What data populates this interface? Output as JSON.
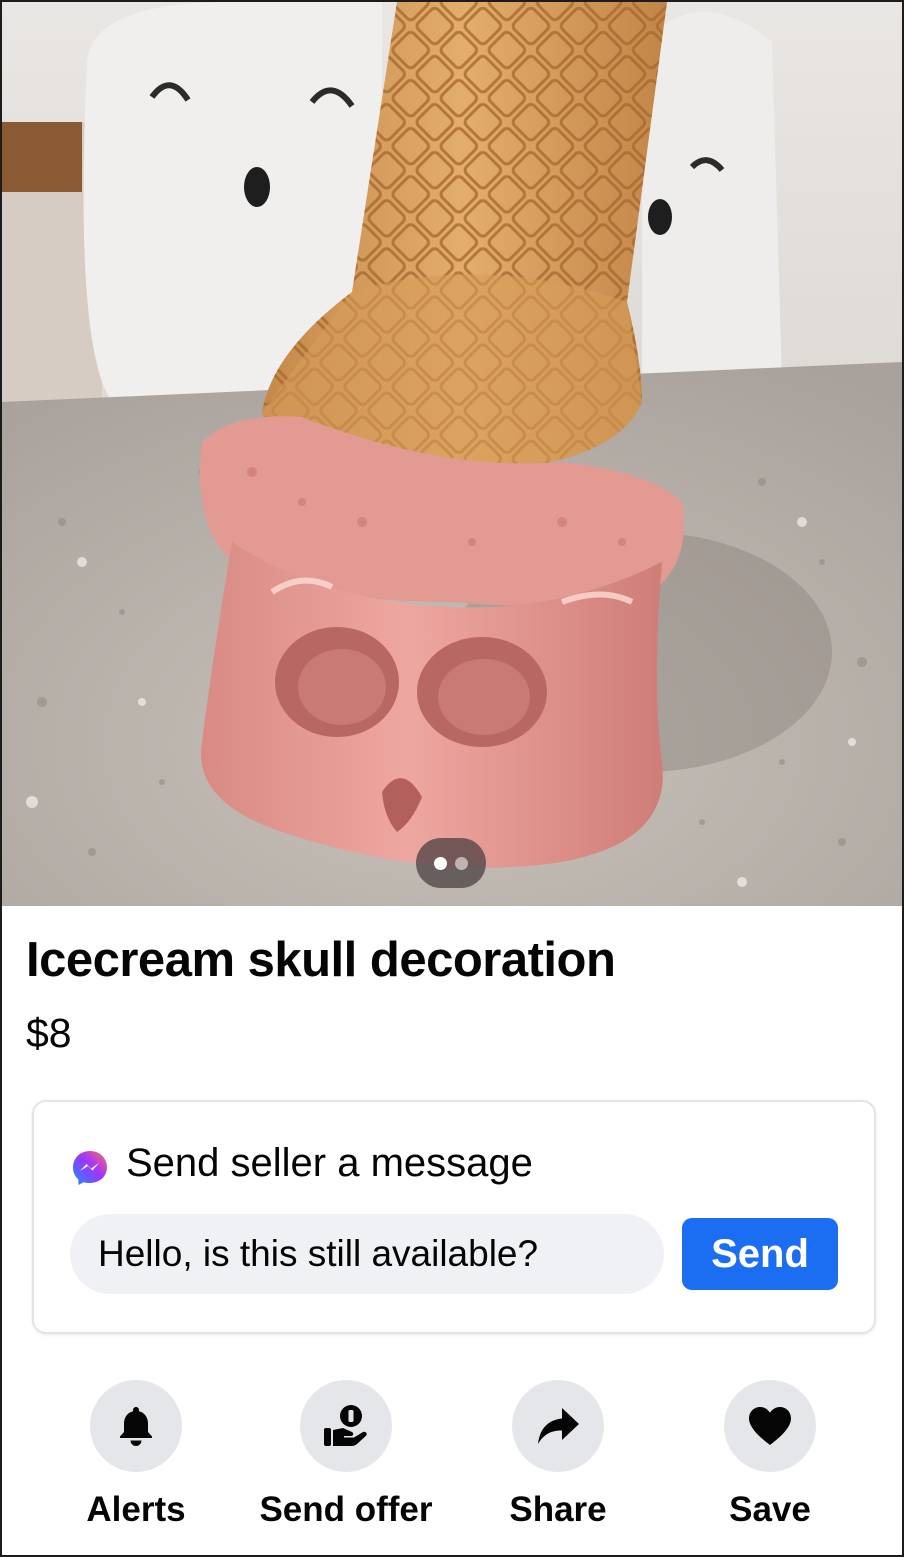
{
  "listing": {
    "title": "Icecream skull decoration",
    "price": "$8",
    "photo": {
      "description_icon": "photo-ice-cream-skull",
      "pager_total": 2,
      "pager_current": 1
    }
  },
  "message": {
    "heading": "Send seller a message",
    "input_value": "Hello, is this still available?",
    "send_label": "Send",
    "icon": "messenger-icon"
  },
  "actions": [
    {
      "label": "Alerts",
      "icon": "bell-icon"
    },
    {
      "label": "Send offer",
      "icon": "offer-icon"
    },
    {
      "label": "Share",
      "icon": "share-icon"
    },
    {
      "label": "Save",
      "icon": "heart-icon"
    }
  ],
  "colors": {
    "accent": "#1b6ef2",
    "icon_circle": "#e4e6ea",
    "text": "#050505"
  }
}
